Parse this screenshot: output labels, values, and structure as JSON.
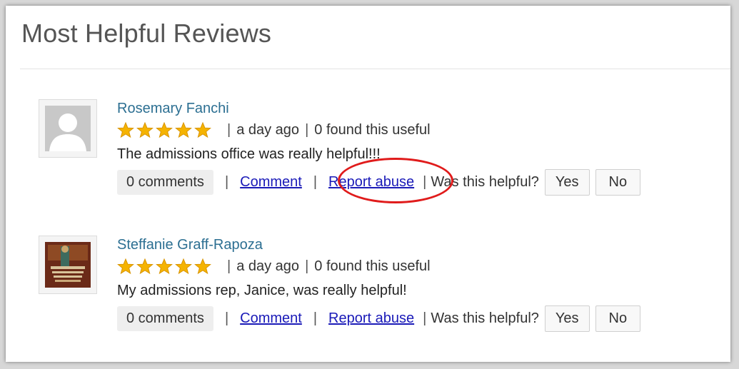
{
  "page": {
    "title": "Most Helpful Reviews"
  },
  "reviews": [
    {
      "avatar": "default-user-avatar",
      "name": "Rosemary Fanchi",
      "rating": 5,
      "time": "a day ago",
      "useful": "0 found this useful",
      "text": "The admissions office was really helpful!!!",
      "comments": "0 comments",
      "comment_link": "Comment",
      "report_link": "Report abuse",
      "helpful_prompt": "Was this helpful?",
      "yes_label": "Yes",
      "no_label": "No"
    },
    {
      "avatar": "book-cover-avatar",
      "name": "Steffanie Graff-Rapoza",
      "rating": 5,
      "time": "a day ago",
      "useful": "0 found this useful",
      "text": "My admissions rep, Janice, was really helpful!",
      "comments": "0 comments",
      "comment_link": "Comment",
      "report_link": "Report abuse",
      "helpful_prompt": "Was this helpful?",
      "yes_label": "Yes",
      "no_label": "No"
    }
  ],
  "separator": "|",
  "colors": {
    "name": "#2c6f92",
    "link": "#1a1ab8",
    "star": "#f5b301",
    "highlight": "#e01b1b"
  },
  "annotation": {
    "shape": "red-oval",
    "target": "report-abuse-link-1"
  }
}
